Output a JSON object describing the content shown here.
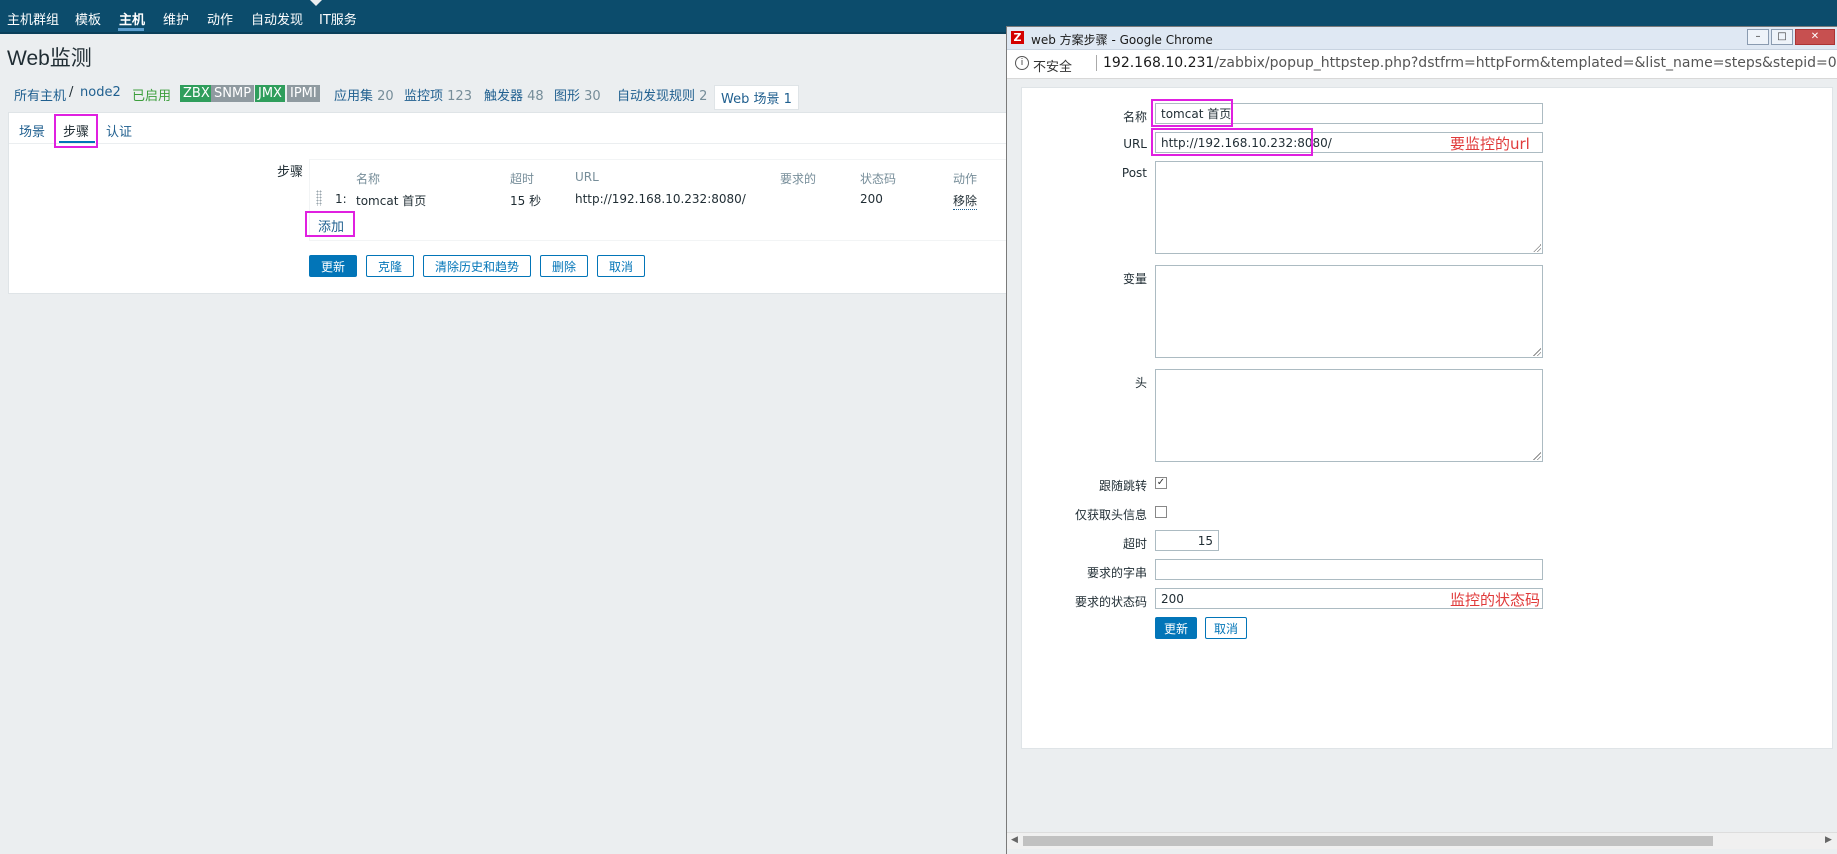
{
  "topnav": {
    "items": [
      "主机群组",
      "模板",
      "主机",
      "维护",
      "动作",
      "自动发现",
      "IT服务"
    ],
    "active_index": 2
  },
  "page": {
    "title": "Web监测"
  },
  "breadcrumbs": {
    "all_hosts": "所有主机",
    "sep": "/",
    "host": "node2",
    "enabled": "已启用",
    "tags": [
      {
        "label": "ZBX",
        "color": "#2f9e5c"
      },
      {
        "label": "SNMP",
        "color": "#8f9aa0"
      },
      {
        "label": "JMX",
        "color": "#2f9e5c"
      },
      {
        "label": "IPMI",
        "color": "#8f9aa0"
      }
    ],
    "links": [
      {
        "label": "应用集",
        "count": "20"
      },
      {
        "label": "监控项",
        "count": "123"
      },
      {
        "label": "触发器",
        "count": "48"
      },
      {
        "label": "图形",
        "count": "30"
      },
      {
        "label": "自动发现规则",
        "count": "2"
      }
    ],
    "web_scenarios": {
      "label": "Web 场景",
      "count": "1"
    }
  },
  "tabs": [
    "场景",
    "步骤",
    "认证"
  ],
  "active_tab_index": 1,
  "steps": {
    "label": "步骤",
    "headers": {
      "name": "名称",
      "timeout": "超时",
      "url": "URL",
      "required": "要求的",
      "status": "状态码",
      "action": "动作"
    },
    "rows": [
      {
        "num": "1:",
        "name": "tomcat 首页",
        "timeout": "15 秒",
        "url": "http://192.168.10.232:8080/",
        "required": "",
        "status": "200",
        "action": "移除"
      }
    ],
    "add_label": "添加"
  },
  "buttons": {
    "update": "更新",
    "clone": "克隆",
    "clear": "清除历史和趋势",
    "delete": "删除",
    "cancel": "取消"
  },
  "popup": {
    "window_title": "web 方案步骤 - Google Chrome",
    "logo": "Z",
    "insecure": "不安全",
    "url_host": "192.168.10.231",
    "url_path": "/zabbix/popup_httpstep.php?dstfrm=httpForm&templated=&list_name=steps&stepid=0&...",
    "form": {
      "name_label": "名称",
      "name_value": "tomcat 首页",
      "url_label": "URL",
      "url_value": "http://192.168.10.232:8080/",
      "post_label": "Post",
      "vars_label": "变量",
      "headers_label": "头",
      "follow_label": "跟随跳转",
      "follow_checked": true,
      "headers_only_label": "仅获取头信息",
      "headers_only_checked": false,
      "timeout_label": "超时",
      "timeout_value": "15",
      "required_string_label": "要求的字串",
      "required_string_value": "",
      "required_status_label": "要求的状态码",
      "required_status_value": "200",
      "update_button": "更新",
      "cancel_button": "取消"
    },
    "annotations": {
      "url_note": "要监控的url",
      "status_note": "监控的状态码"
    }
  },
  "colors": {
    "nav_bg": "#0c4c6c",
    "primary": "#0275b8",
    "highlight": "#e020e0",
    "annotation": "#e03a3a"
  }
}
